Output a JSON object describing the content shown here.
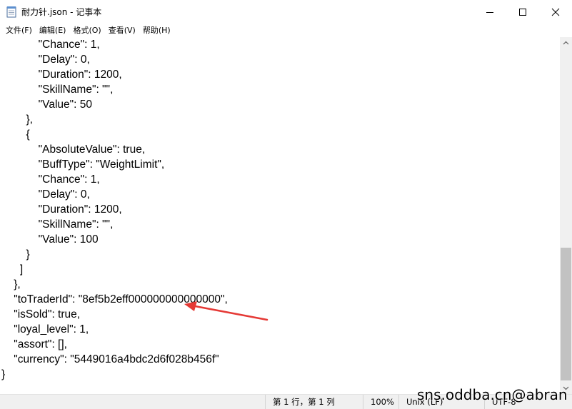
{
  "window": {
    "title": "耐力针.json - 记事本",
    "icon": "notepad-icon",
    "buttons": [
      "minimize-icon",
      "maximize-icon",
      "close-icon"
    ]
  },
  "menu": [
    "文件(F)",
    "编辑(E)",
    "格式(O)",
    "查看(V)",
    "帮助(H)"
  ],
  "lines": [
    "            \"Chance\": 1,",
    "            \"Delay\": 0,",
    "            \"Duration\": 1200,",
    "            \"SkillName\": \"\",",
    "            \"Value\": 50",
    "        },",
    "        {",
    "            \"AbsoluteValue\": true,",
    "            \"BuffType\": \"WeightLimit\",",
    "            \"Chance\": 1,",
    "            \"Delay\": 0,",
    "            \"Duration\": 1200,",
    "            \"SkillName\": \"\",",
    "            \"Value\": 100",
    "        }",
    "      ]",
    "    },",
    "    \"toTraderId\": \"8ef5b2eff000000000000000\",",
    "    \"isSold\": true,",
    "    \"loyal_level\": 1,",
    "    \"assort\": [],",
    "    \"currency\": \"5449016a4bdc2d6f028b456f\"",
    "}"
  ],
  "status": {
    "position": "第 1 行，第 1 列",
    "zoom": "100%",
    "line_ending": "Unix (LF)",
    "encoding": "UTF-8"
  },
  "watermark": "sns.oddba.cn@abran",
  "annotation": {
    "color": "#e53935"
  }
}
